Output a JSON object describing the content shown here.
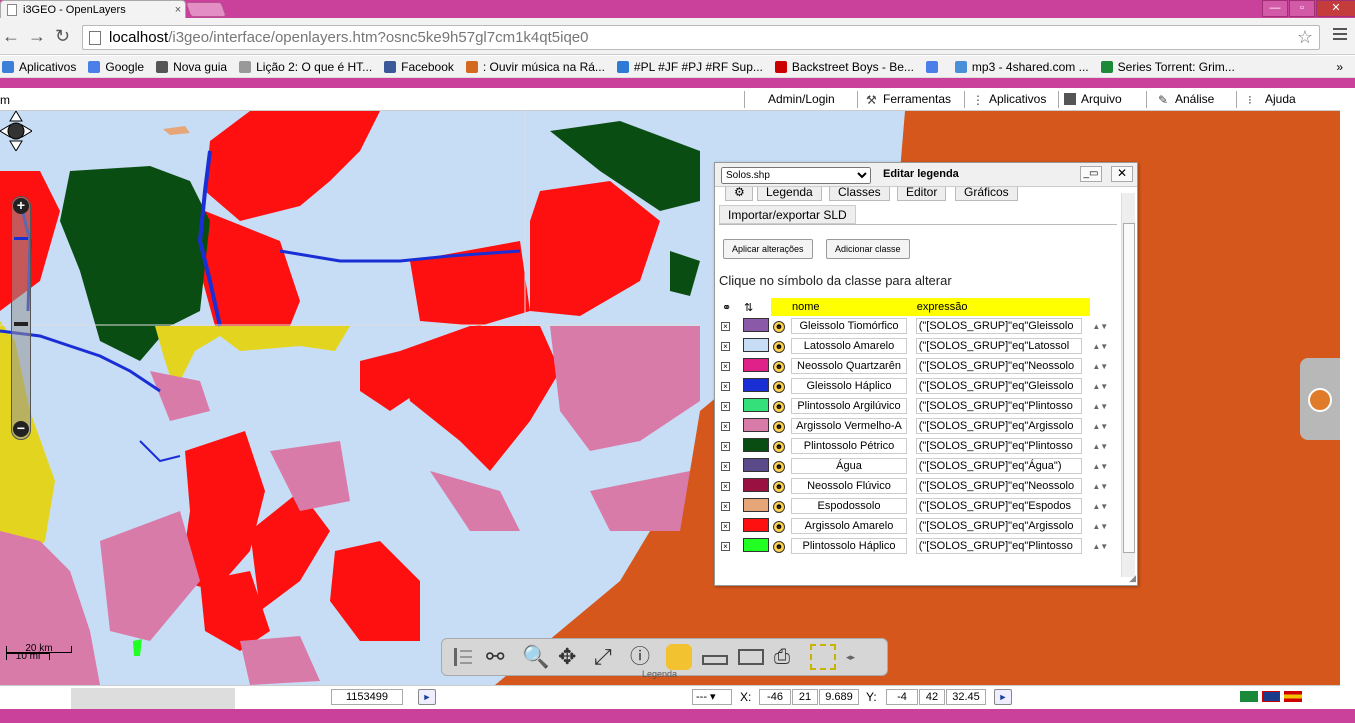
{
  "browser": {
    "tab_title": "i3GEO - OpenLayers",
    "tab_close": "×",
    "url_host": "localhost",
    "url_path": "/i3geo/interface/openlayers.htm?osnc5ke9h57gl7cm1k4qt5iqe0",
    "window_controls": [
      "—",
      "▫",
      "✕"
    ],
    "bookmarks": [
      {
        "label": "Aplicativos",
        "color": "#3c7fd9"
      },
      {
        "label": "Google",
        "color": "#4a7ee8"
      },
      {
        "label": "Nova guia",
        "color": "#555555"
      },
      {
        "label": "Lição 2: O que é HT...",
        "color": "#999999"
      },
      {
        "label": "Facebook",
        "color": "#3b5998"
      },
      {
        "label": ": Ouvir música na Rá...",
        "color": "#d2691e"
      },
      {
        "label": "#PL #JF #PJ #RF Sup...",
        "color": "#2e7bd6"
      },
      {
        "label": "Backstreet Boys - Be...",
        "color": "#cc0000"
      },
      {
        "label": "",
        "color": "#4a7ee8"
      },
      {
        "label": "mp3 - 4shared.com ...",
        "color": "#4a90d9"
      },
      {
        "label": "Series Torrent: Grim...",
        "color": "#1d8a3a"
      }
    ],
    "overflow": "»"
  },
  "appmenu": {
    "left_text": "m",
    "items": [
      {
        "label": "Admin/Login"
      },
      {
        "label": "Ferramentas"
      },
      {
        "label": "Aplicativos"
      },
      {
        "label": "Arquivo"
      },
      {
        "label": "Análise"
      },
      {
        "label": "Ajuda"
      }
    ]
  },
  "map": {
    "scale_km": "20 km",
    "scale_mi": "10 mi",
    "zoom_in": "+",
    "zoom_out": "−"
  },
  "legend_window": {
    "layer_select": "Solos.shp",
    "title": "Editar legenda",
    "tabs": [
      "",
      "Legenda",
      "Classes",
      "Editor",
      "Gráficos"
    ],
    "sld_tab": "Importar/exportar SLD",
    "apply_button": "Aplicar alterações",
    "add_class_button": "Adicionar classe",
    "hint": "Clique no símbolo da classe para alterar",
    "col_name": "nome",
    "col_expr": "expressão",
    "classes": [
      {
        "name": "Gleissolo Tiomórfico",
        "expr": "(\"[SOLOS_GRUP]\"eq\"Gleissolo",
        "color": "#8a5aa8"
      },
      {
        "name": "Latossolo Amarelo",
        "expr": "(\"[SOLOS_GRUP]\"eq\"Latossol",
        "color": "#c7ddf5"
      },
      {
        "name": "Neossolo Quartzarên",
        "expr": "(\"[SOLOS_GRUP]\"eq\"Neossolo",
        "color": "#e0218a"
      },
      {
        "name": "Gleissolo Háplico",
        "expr": "(\"[SOLOS_GRUP]\"eq\"Gleissolo",
        "color": "#1a2ed6"
      },
      {
        "name": "Plintossolo Argilúvico",
        "expr": "(\"[SOLOS_GRUP]\"eq\"Plintosso",
        "color": "#33e07a"
      },
      {
        "name": "Argissolo Vermelho-A",
        "expr": "(\"[SOLOS_GRUP]\"eq\"Argissolo",
        "color": "#d97ba8"
      },
      {
        "name": "Plintossolo Pétrico",
        "expr": "(\"[SOLOS_GRUP]\"eq\"Plintosso",
        "color": "#0a4d12"
      },
      {
        "name": "Água",
        "expr": "(\"[SOLOS_GRUP]\"eq\"Água\")",
        "color": "#5a4a8a"
      },
      {
        "name": "Neossolo Flúvico",
        "expr": "(\"[SOLOS_GRUP]\"eq\"Neossolo",
        "color": "#9a1040"
      },
      {
        "name": "Espodossolo",
        "expr": "(\"[SOLOS_GRUP]\"eq\"Espodos",
        "color": "#e6a678"
      },
      {
        "name": "Argissolo Amarelo",
        "expr": "(\"[SOLOS_GRUP]\"eq\"Argissolo",
        "color": "#ff1010"
      },
      {
        "name": "Plintossolo Háplico",
        "expr": "(\"[SOLOS_GRUP]\"eq\"Plintosso",
        "color": "#22ff22"
      }
    ]
  },
  "toolsbar": {
    "label": "Legenda"
  },
  "statusbar": {
    "scale_value": "1153499",
    "projection_select": "---",
    "x_label": "X:",
    "x_deg": "-46",
    "x_min": "21",
    "x_sec": "9.689",
    "y_label": "Y:",
    "y_deg": "-4",
    "y_min": "42",
    "y_sec": "32.45"
  }
}
